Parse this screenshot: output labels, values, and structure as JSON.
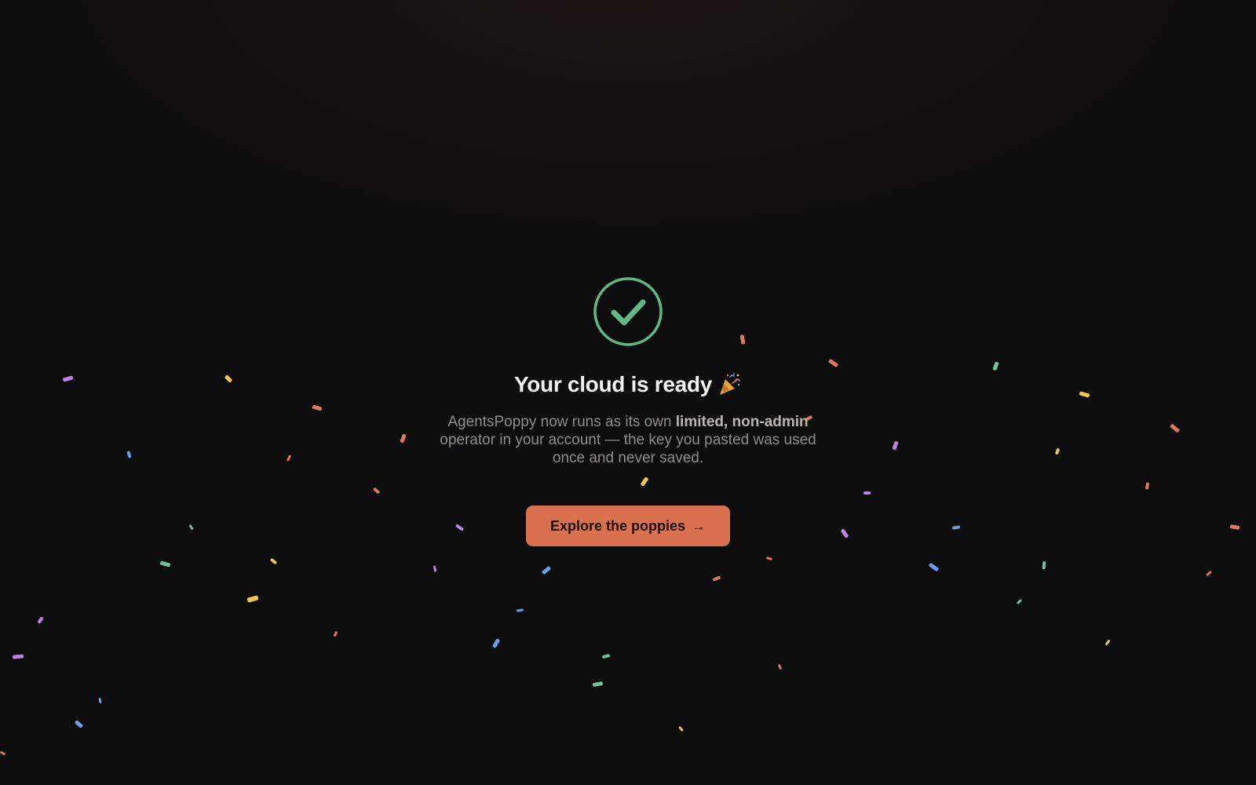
{
  "colors": {
    "success": "#5fb985",
    "accent": "#d9714f",
    "background": "#0d0d0d",
    "confetti": [
      "#e0785a",
      "#f2c64d",
      "#6bc49a",
      "#6b9ee6",
      "#c281e6"
    ]
  },
  "icons": {
    "status": "check-circle-icon",
    "celebration": "party-popper-icon"
  },
  "success": {
    "title": "Your cloud is ready",
    "message": {
      "part1": "AgentsPoppy now runs as its own ",
      "emphasis": "limited, non-admin",
      "part2": " operator in your account — the key you pasted was used once and never saved."
    },
    "cta_label": "Explore the poppies",
    "cta_arrow": "→"
  }
}
